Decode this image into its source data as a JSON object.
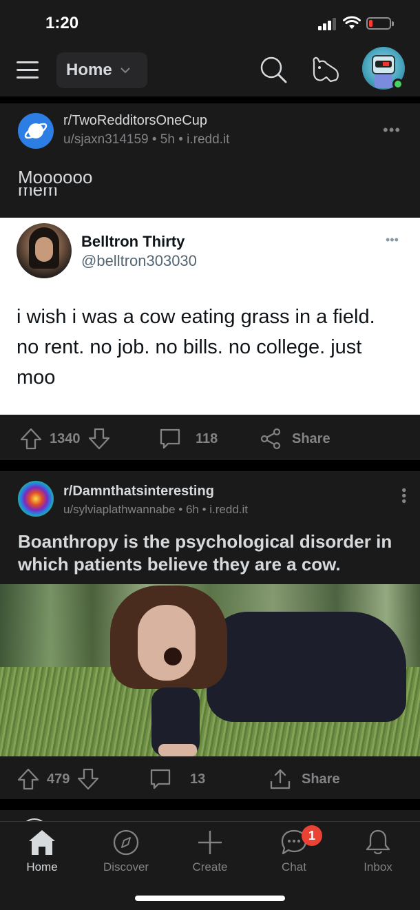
{
  "status_bar": {
    "time": "1:20"
  },
  "header": {
    "feed_label": "Home"
  },
  "posts": [
    {
      "subreddit": "r/TwoRedditorsOneCup",
      "meta": "u/sjaxn314159 • 5h • i.redd.it",
      "title": "Moooooo",
      "cut_text": "mem",
      "tweet": {
        "name": "Belltron Thirty",
        "handle": "@belltron303030",
        "text": "i wish i was a cow eating grass in a field. no rent. no job. no bills. no college. just moo"
      },
      "votes": "1340",
      "comments": "118",
      "share_label": "Share"
    },
    {
      "subreddit": "r/Damnthatsinteresting",
      "meta": "u/sylviaplathwannabe • 6h • i.redd.it",
      "title": "Boanthropy is the psychological disorder in which patients believe they are a cow.",
      "votes": "479",
      "comments": "13",
      "share_label": "Share"
    }
  ],
  "tabs": [
    {
      "label": "Home",
      "icon": "home-icon",
      "active": true
    },
    {
      "label": "Discover",
      "icon": "compass-icon"
    },
    {
      "label": "Create",
      "icon": "plus-icon"
    },
    {
      "label": "Chat",
      "icon": "chat-icon",
      "badge": "1"
    },
    {
      "label": "Inbox",
      "icon": "bell-icon"
    }
  ],
  "colors": {
    "background": "#000000",
    "surface": "#1a1a1b",
    "text": "#d7dadc",
    "muted": "#818384",
    "badge": "#ea4335",
    "online": "#46d160"
  }
}
